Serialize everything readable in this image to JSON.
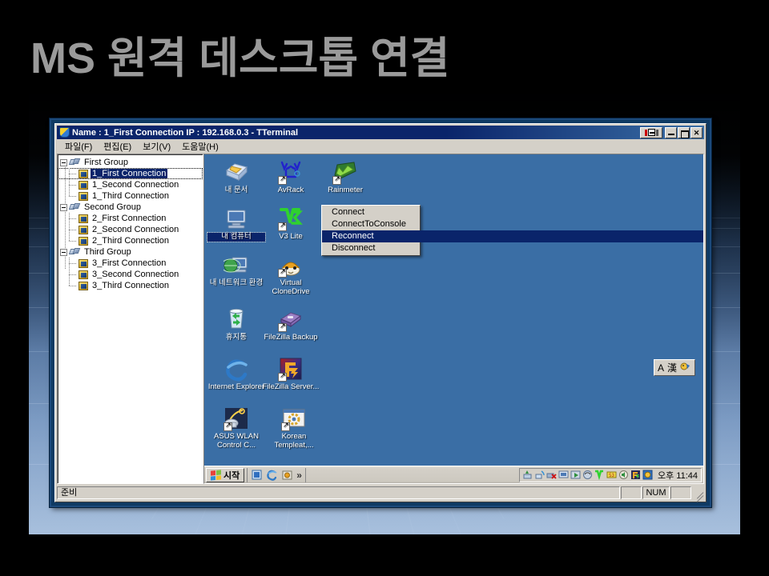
{
  "slide": {
    "title": "MS 원격 데스크톱 연결",
    "title_color": "#9a9a9a",
    "background_color": "#000000",
    "accent_color": "#3a6ea5"
  },
  "window": {
    "titlebar": {
      "icon": "shield-icon",
      "text": "Name : 1_First Connection  IP : 192.168.0.3 - TTerminal",
      "buttons": {
        "pin": "dock-pin-button",
        "minimize": "_",
        "maximize": "□",
        "close": "✕"
      }
    },
    "menubar": [
      {
        "label": "파일(F)",
        "accel": "F"
      },
      {
        "label": "편집(E)",
        "accel": "E"
      },
      {
        "label": "보기(V)",
        "accel": "V"
      },
      {
        "label": "도움말(H)",
        "accel": "H"
      }
    ],
    "statusbar": {
      "text": "준비",
      "num_indicator": "NUM"
    }
  },
  "tree": {
    "groups": [
      {
        "label": "First Group",
        "expanded": true,
        "children": [
          {
            "label": "1_First Connection",
            "selected": true
          },
          {
            "label": "1_Second Connection",
            "selected": false
          },
          {
            "label": "1_Third Connection",
            "selected": false
          }
        ]
      },
      {
        "label": "Second Group",
        "expanded": true,
        "children": [
          {
            "label": "2_First Connection",
            "selected": false
          },
          {
            "label": "2_Second Connection",
            "selected": false
          },
          {
            "label": "2_Third Connection",
            "selected": false
          }
        ]
      },
      {
        "label": "Third Group",
        "expanded": true,
        "children": [
          {
            "label": "3_First Connection",
            "selected": false
          },
          {
            "label": "3_Second Connection",
            "selected": false
          },
          {
            "label": "3_Third Connection",
            "selected": false
          }
        ]
      }
    ]
  },
  "context_menu": {
    "items": [
      {
        "label": "Connect",
        "highlighted": false
      },
      {
        "label": "ConnectToConsole",
        "highlighted": false
      },
      {
        "label": "Reconnect",
        "highlighted": true
      },
      {
        "label": "Disconnect",
        "highlighted": false
      }
    ]
  },
  "desktop": {
    "background_color": "#3a6ea5",
    "icons": [
      {
        "label": "내 문서",
        "icon": "documents-icon",
        "col": 0,
        "row": 0,
        "selected": false
      },
      {
        "label": "AvRack",
        "icon": "avrack-icon",
        "col": 1,
        "row": 0,
        "selected": false
      },
      {
        "label": "Rainmeter",
        "icon": "rainmeter-icon",
        "col": 2,
        "row": 0,
        "selected": false
      },
      {
        "label": "내 컴퓨터",
        "icon": "my-computer-icon",
        "col": 0,
        "row": 1,
        "selected": true
      },
      {
        "label": "V3 Lite",
        "icon": "v3-lite-icon",
        "col": 1,
        "row": 1,
        "selected": false
      },
      {
        "label": "내 네트워크 환경",
        "icon": "network-places-icon",
        "col": 0,
        "row": 2,
        "selected": false
      },
      {
        "label": "Virtual CloneDrive",
        "icon": "virtual-clonedrive-icon",
        "col": 1,
        "row": 2,
        "selected": false
      },
      {
        "label": "휴지통",
        "icon": "recycle-bin-icon",
        "col": 0,
        "row": 3,
        "selected": false
      },
      {
        "label": "FileZilla Backup",
        "icon": "filezilla-backup-icon",
        "col": 1,
        "row": 3,
        "selected": false
      },
      {
        "label": "Internet Explorer",
        "icon": "internet-explorer-icon",
        "col": 0,
        "row": 4,
        "selected": false
      },
      {
        "label": "FileZilla Server...",
        "icon": "filezilla-server-icon",
        "col": 1,
        "row": 4,
        "selected": false
      },
      {
        "label": "ASUS WLAN Control C...",
        "icon": "asus-wlan-icon",
        "col": 0,
        "row": 5,
        "selected": false
      },
      {
        "label": "Korean Templeat,...",
        "icon": "korean-template-icon",
        "col": 1,
        "row": 5,
        "selected": false
      }
    ],
    "taskbar": {
      "start_label": "시작",
      "quick_launch": [
        "show-desktop-icon",
        "internet-explorer-icon",
        "media-player-icon"
      ],
      "overflow": "»",
      "tray_icons": [
        "safely-remove-icon",
        "network-connection-icon",
        "network-error-icon",
        "display-icon",
        "media-icon",
        "shield-icon",
        "v3-lite-icon",
        "s3-icon",
        "speaker-icon",
        "filezilla-icon",
        "rainmeter-icon"
      ],
      "clock": "오후 11:44"
    },
    "ime_bar": {
      "mode": "A",
      "hanja": "漢",
      "icon": "ime-pad-icon"
    }
  }
}
